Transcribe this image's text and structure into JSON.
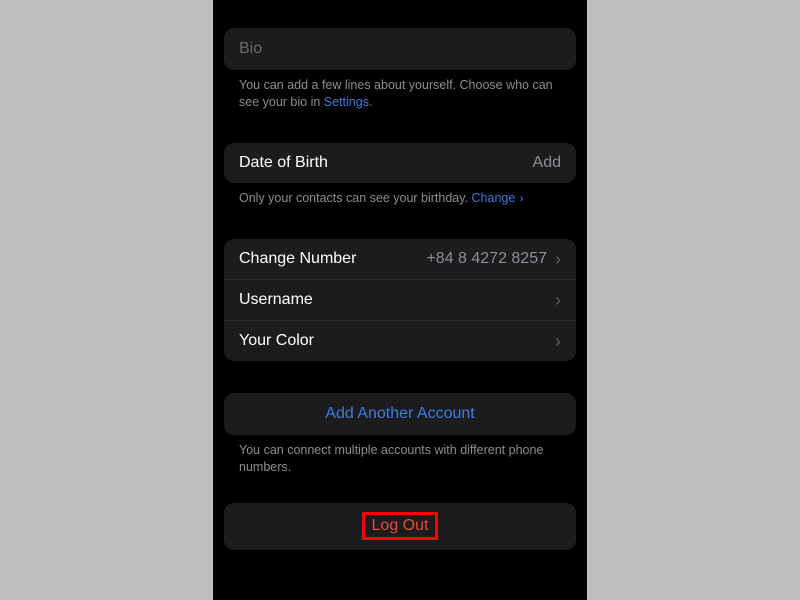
{
  "bio": {
    "placeholder": "Bio",
    "hint_before": "You can add a few lines about yourself. Choose who can see your bio in ",
    "hint_link": "Settings",
    "hint_after": "."
  },
  "dob": {
    "label": "Date of Birth",
    "value": "Add",
    "hint_before": "Only your contacts can see your birthday. ",
    "hint_link": "Change"
  },
  "account": {
    "change_number_label": "Change Number",
    "change_number_value": "+84 8 4272 8257",
    "username_label": "Username",
    "color_label": "Your Color"
  },
  "add_account": {
    "label": "Add Another Account",
    "hint": "You can connect multiple accounts with different phone numbers."
  },
  "logout": {
    "label": "Log Out"
  }
}
